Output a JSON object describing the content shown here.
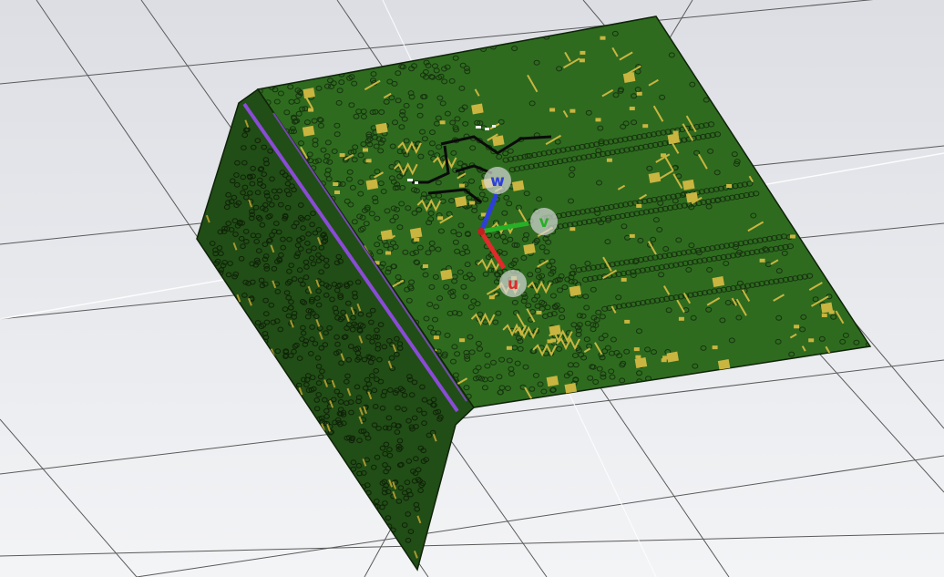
{
  "view": {
    "background_top": "#dcdee4",
    "background_bottom": "#f3f4f6",
    "grid_color": "#5a5a5a",
    "highlight_grid_color": "#ffffff"
  },
  "board": {
    "top_color": "#2e6b1f",
    "side_color": "#214d16",
    "outline_color": "#0f2308",
    "trace_color": "#c9b540",
    "via_color": "#17330f",
    "seam_color": "#8a4bd6",
    "black_trace_color": "#0b0b0b"
  },
  "triad": {
    "u": {
      "label": "u",
      "color": "#e02b2b"
    },
    "v": {
      "label": "v",
      "color": "#27b027"
    },
    "w": {
      "label": "w",
      "color": "#2d3fd8"
    }
  }
}
